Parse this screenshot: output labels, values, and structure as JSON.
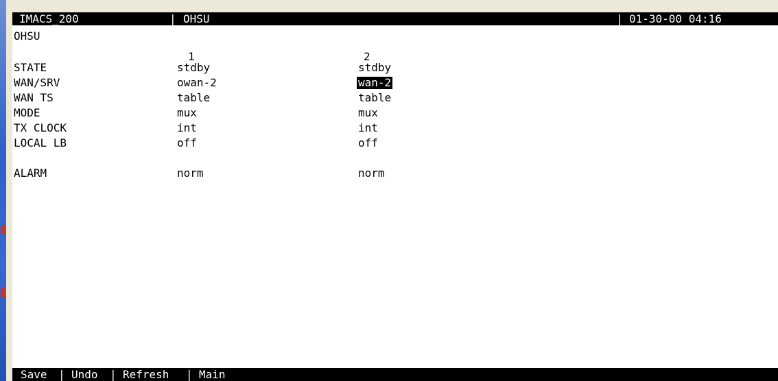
{
  "header": {
    "system": "IMACS_200",
    "screen": "OHSU",
    "datetime": "01-30-00 04:16"
  },
  "title": "OHSU",
  "columns": [
    "1",
    "2"
  ],
  "rows": [
    {
      "label": "STATE",
      "values": [
        "stdby",
        "stdby"
      ]
    },
    {
      "label": "WAN/SRV",
      "values": [
        "owan-2",
        "wan-2"
      ]
    },
    {
      "label": "WAN TS",
      "values": [
        "table",
        "table"
      ]
    },
    {
      "label": "MODE",
      "values": [
        "mux",
        "mux"
      ]
    },
    {
      "label": "TX CLOCK",
      "values": [
        "int",
        "int"
      ]
    },
    {
      "label": "LOCAL LB",
      "values": [
        "off",
        "off"
      ]
    },
    {
      "label": "ALARM",
      "values": [
        "norm",
        "norm"
      ]
    }
  ],
  "softkeys": {
    "save": "Save",
    "undo": "Undo",
    "refresh": "Refresh",
    "main": "Main"
  },
  "colors": {
    "bar_background": "#000000",
    "bar_text": "#ffffff",
    "selection_background": "#000000",
    "window_chrome": "#ece9d8",
    "desktop_blue": "#2f5fc7"
  }
}
